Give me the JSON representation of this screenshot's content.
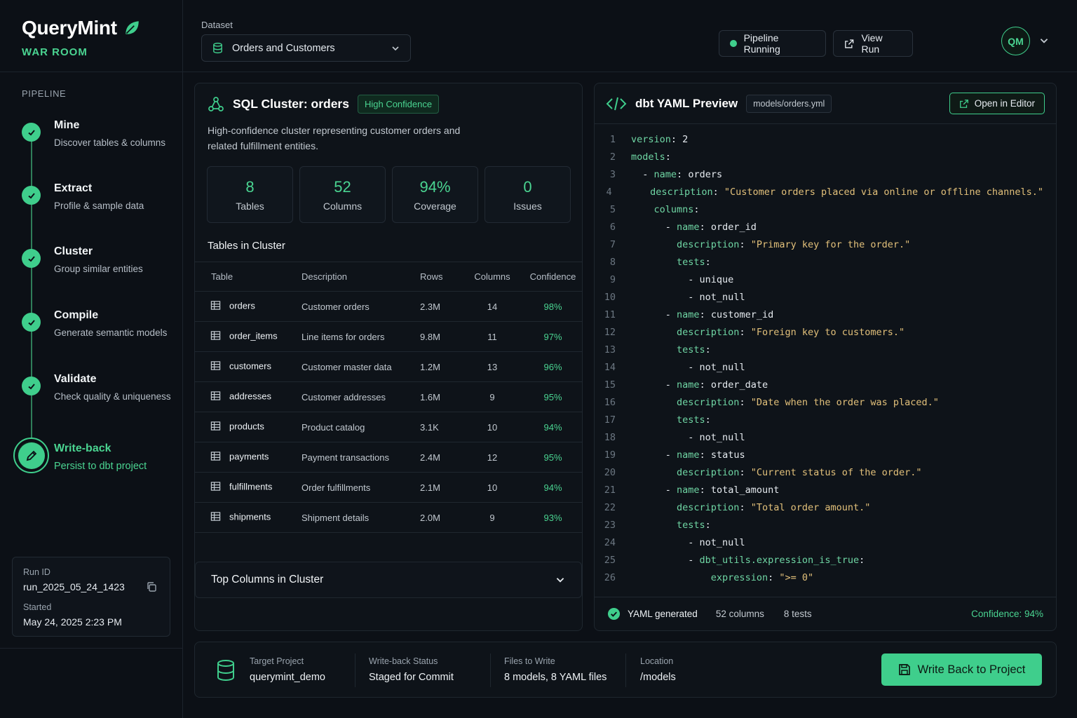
{
  "brand": {
    "name": "QueryMint",
    "sub": "WAR ROOM"
  },
  "sidebar": {
    "section": "PIPELINE",
    "steps": [
      {
        "title": "Mine",
        "desc": "Discover tables & columns",
        "status": "done"
      },
      {
        "title": "Extract",
        "desc": "Profile & sample data",
        "status": "done"
      },
      {
        "title": "Cluster",
        "desc": "Group similar entities",
        "status": "done"
      },
      {
        "title": "Compile",
        "desc": "Generate semantic models",
        "status": "done"
      },
      {
        "title": "Validate",
        "desc": "Check quality & uniqueness",
        "status": "done"
      },
      {
        "title": "Write-back",
        "desc": "Persist to dbt project",
        "status": "active"
      }
    ],
    "run": {
      "id_label": "Run ID",
      "id": "run_2025_05_24_1423",
      "started_label": "Started",
      "started": "May 24, 2025 2:23 PM"
    }
  },
  "header": {
    "dataset_label": "Dataset",
    "dataset": "Orders and Customers",
    "status": "Pipeline Running",
    "view_run": "View Run",
    "avatar": "QM"
  },
  "cluster": {
    "title": "SQL Cluster: orders",
    "badge": "High Confidence",
    "description": "High-confidence cluster representing customer orders and related fulfillment entities.",
    "stats": [
      {
        "value": "8",
        "label": "Tables"
      },
      {
        "value": "52",
        "label": "Columns"
      },
      {
        "value": "94%",
        "label": "Coverage"
      },
      {
        "value": "0",
        "label": "Issues"
      }
    ],
    "tables_title": "Tables in Cluster",
    "columns": [
      "Table",
      "Description",
      "Rows",
      "Columns",
      "Confidence"
    ],
    "rows": [
      [
        "orders",
        "Customer orders",
        "2.3M",
        "14",
        "98%"
      ],
      [
        "order_items",
        "Line items for orders",
        "9.8M",
        "11",
        "97%"
      ],
      [
        "customers",
        "Customer master data",
        "1.2M",
        "13",
        "96%"
      ],
      [
        "addresses",
        "Customer addresses",
        "1.6M",
        "9",
        "95%"
      ],
      [
        "products",
        "Product catalog",
        "3.1K",
        "10",
        "94%"
      ],
      [
        "payments",
        "Payment transactions",
        "2.4M",
        "12",
        "95%"
      ],
      [
        "fulfillments",
        "Order fulfillments",
        "2.1M",
        "10",
        "94%"
      ],
      [
        "shipments",
        "Shipment details",
        "2.0M",
        "9",
        "93%"
      ]
    ],
    "accordion": "Top Columns in Cluster"
  },
  "yaml": {
    "title": "dbt YAML Preview",
    "file": "models/orders.yml",
    "open": "Open in Editor",
    "lines": [
      {
        "i": 0,
        "k": "version",
        "v": "2",
        "t": "v"
      },
      {
        "i": 0,
        "k": "models",
        "v": "",
        "t": "v"
      },
      {
        "i": 2,
        "d": "- ",
        "k": "name",
        "v": "orders",
        "t": "v"
      },
      {
        "i": 4,
        "k": "description",
        "v": "\"Customer orders placed via online or offline channels.\"",
        "t": "s"
      },
      {
        "i": 4,
        "k": "columns",
        "v": "",
        "t": "v"
      },
      {
        "i": 6,
        "d": "- ",
        "k": "name",
        "v": "order_id",
        "t": "v"
      },
      {
        "i": 8,
        "k": "description",
        "v": "\"Primary key for the order.\"",
        "t": "s"
      },
      {
        "i": 8,
        "k": "tests",
        "v": "",
        "t": "v"
      },
      {
        "i": 10,
        "d": "- ",
        "v": "unique",
        "t": "v"
      },
      {
        "i": 10,
        "d": "- ",
        "v": "not_null",
        "t": "v"
      },
      {
        "i": 6,
        "d": "- ",
        "k": "name",
        "v": "customer_id",
        "t": "v"
      },
      {
        "i": 8,
        "k": "description",
        "v": "\"Foreign key to customers.\"",
        "t": "s"
      },
      {
        "i": 8,
        "k": "tests",
        "v": "",
        "t": "v"
      },
      {
        "i": 10,
        "d": "- ",
        "v": "not_null",
        "t": "v"
      },
      {
        "i": 6,
        "d": "- ",
        "k": "name",
        "v": "order_date",
        "t": "v"
      },
      {
        "i": 8,
        "k": "description",
        "v": "\"Date when the order was placed.\"",
        "t": "s"
      },
      {
        "i": 8,
        "k": "tests",
        "v": "",
        "t": "v"
      },
      {
        "i": 10,
        "d": "- ",
        "v": "not_null",
        "t": "v"
      },
      {
        "i": 6,
        "d": "- ",
        "k": "name",
        "v": "status",
        "t": "v"
      },
      {
        "i": 8,
        "k": "description",
        "v": "\"Current status of the order.\"",
        "t": "s"
      },
      {
        "i": 6,
        "d": "- ",
        "k": "name",
        "v": "total_amount",
        "t": "v"
      },
      {
        "i": 8,
        "k": "description",
        "v": "\"Total order amount.\"",
        "t": "s"
      },
      {
        "i": 8,
        "k": "tests",
        "v": "",
        "t": "v"
      },
      {
        "i": 10,
        "d": "- ",
        "v": "not_null",
        "t": "v"
      },
      {
        "i": 10,
        "d": "- ",
        "k": "dbt_utils.expression_is_true",
        "v": "",
        "t": "v"
      },
      {
        "i": 14,
        "k": "expression",
        "v": "\">= 0\"",
        "t": "s"
      }
    ],
    "footer": {
      "generated": "YAML generated",
      "columns": "52 columns",
      "tests": "8 tests",
      "confidence": "Confidence: 94%"
    }
  },
  "writeback": {
    "target_label": "Target Project",
    "target": "querymint_demo",
    "status_label": "Write-back Status",
    "status": "Staged for Commit",
    "files_label": "Files to Write",
    "files": "8 models, 8 YAML files",
    "location_label": "Location",
    "location": "/models",
    "button": "Write Back to Project"
  },
  "colors": {
    "accent": "#3fce8c",
    "background": "#0c1016",
    "yaml_string": "#e2c07a",
    "yaml_key": "#6fd6a4"
  },
  "icons": [
    "leaf-icon",
    "check-icon",
    "pencil-icon",
    "copy-icon",
    "database-icon",
    "chevron-down-icon",
    "status-dot-icon",
    "external-link-icon",
    "cluster-icon",
    "code-icon",
    "table-icon",
    "check-circle-icon",
    "save-icon"
  ]
}
